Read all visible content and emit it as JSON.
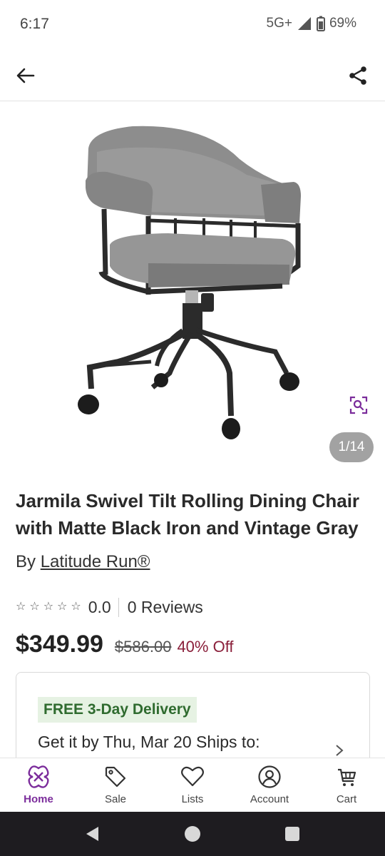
{
  "status": {
    "time": "6:17",
    "network": "5G+",
    "battery": "69%"
  },
  "header": {
    "back_icon": "arrow-left-icon",
    "share_icon": "share-icon"
  },
  "gallery": {
    "counter": "1/14",
    "zoom_icon": "zoom-search-icon"
  },
  "product": {
    "title": "Jarmila Swivel Tilt Rolling Dining Chair with Matte Black Iron and Vintage Gray",
    "brand_prefix": "By",
    "brand_name": "Latitude Run®",
    "stars": [
      "☆",
      "☆",
      "☆",
      "☆",
      "☆"
    ],
    "rating": "0.0",
    "reviews": "0 Reviews",
    "price": "$349.99",
    "original_price": "$586.00",
    "discount": "40% Off"
  },
  "delivery": {
    "badge": "FREE 3-Day Delivery",
    "text": "Get it by Thu, Mar 20 Ships to:"
  },
  "nav": [
    {
      "label": "Home",
      "icon": "home-icon",
      "active": true
    },
    {
      "label": "Sale",
      "icon": "tag-icon",
      "active": false
    },
    {
      "label": "Lists",
      "icon": "heart-icon",
      "active": false
    },
    {
      "label": "Account",
      "icon": "account-icon",
      "active": false
    },
    {
      "label": "Cart",
      "icon": "cart-icon",
      "active": false
    }
  ],
  "colors": {
    "brand_purple": "#7b2c9b",
    "discount_red": "#8a1f3a",
    "delivery_green": "#2f6b2f",
    "badge_bg": "#e6f2e3"
  }
}
